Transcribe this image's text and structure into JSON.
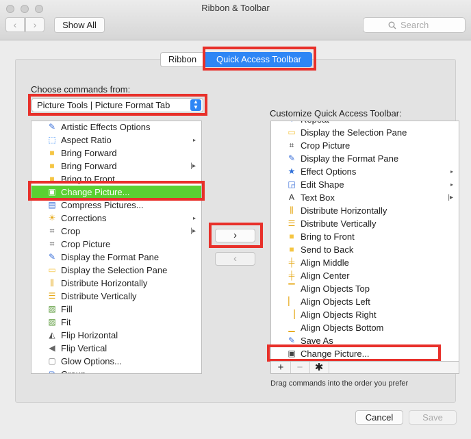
{
  "window": {
    "title": "Ribbon & Toolbar"
  },
  "toolbar": {
    "show_all": "Show All",
    "search_placeholder": "Search",
    "back": "‹",
    "forward": "›"
  },
  "tabs": {
    "ribbon": "Ribbon",
    "qat": "Quick Access Toolbar"
  },
  "left": {
    "label": "Choose commands from:",
    "selected_source": "Picture Tools | Picture Format Tab",
    "items": [
      {
        "label": "Artistic Effects Options",
        "icon": "artistic-effects-icon"
      },
      {
        "label": "Aspect Ratio",
        "icon": "aspect-ratio-icon",
        "sub": "▸"
      },
      {
        "label": "Bring Forward",
        "icon": "bring-forward-icon"
      },
      {
        "label": "Bring Forward",
        "icon": "bring-forward-icon",
        "sub": "|▸"
      },
      {
        "label": "Bring to Front",
        "icon": "bring-to-front-icon"
      },
      {
        "label": "Change Picture...",
        "icon": "change-picture-icon",
        "selected": true
      },
      {
        "label": "Compress Pictures...",
        "icon": "compress-pictures-icon"
      },
      {
        "label": "Corrections",
        "icon": "corrections-icon",
        "sub": "▸"
      },
      {
        "label": "Crop",
        "icon": "crop-icon",
        "sub": "|▸"
      },
      {
        "label": "Crop Picture",
        "icon": "crop-icon"
      },
      {
        "label": "Display the Format Pane",
        "icon": "format-pane-icon"
      },
      {
        "label": "Display the Selection Pane",
        "icon": "selection-pane-icon"
      },
      {
        "label": "Distribute Horizontally",
        "icon": "distribute-horizontally-icon"
      },
      {
        "label": "Distribute Vertically",
        "icon": "distribute-vertically-icon"
      },
      {
        "label": "Fill",
        "icon": "fill-picture-icon"
      },
      {
        "label": "Fit",
        "icon": "fit-picture-icon"
      },
      {
        "label": "Flip Horizontal",
        "icon": "flip-horizontal-icon"
      },
      {
        "label": "Flip Vertical",
        "icon": "flip-vertical-icon"
      },
      {
        "label": "Glow Options...",
        "icon": "glow-options-icon"
      },
      {
        "label": "Group",
        "icon": "group-icon"
      }
    ]
  },
  "move": {
    "add": "›",
    "remove": "‹"
  },
  "right": {
    "label": "Customize Quick Access Toolbar:",
    "items": [
      {
        "label": "Repeat",
        "icon": "repeat-icon"
      },
      {
        "label": "Display the Selection Pane",
        "icon": "selection-pane-icon"
      },
      {
        "label": "Crop Picture",
        "icon": "crop-icon"
      },
      {
        "label": "Display the Format Pane",
        "icon": "format-pane-icon"
      },
      {
        "label": "Effect Options",
        "icon": "effect-options-icon",
        "sub": "▸"
      },
      {
        "label": "Edit Shape",
        "icon": "edit-shape-icon",
        "sub": "▸"
      },
      {
        "label": "Text Box",
        "icon": "text-box-icon",
        "sub": "|▸"
      },
      {
        "label": "Distribute Horizontally",
        "icon": "distribute-horizontally-icon"
      },
      {
        "label": "Distribute Vertically",
        "icon": "distribute-vertically-icon"
      },
      {
        "label": "Bring to Front",
        "icon": "bring-to-front-icon"
      },
      {
        "label": "Send to Back",
        "icon": "send-to-back-icon"
      },
      {
        "label": "Align Middle",
        "icon": "align-middle-icon"
      },
      {
        "label": "Align Center",
        "icon": "align-center-icon"
      },
      {
        "label": "Align Objects Top",
        "icon": "align-top-icon"
      },
      {
        "label": "Align Objects Left",
        "icon": "align-left-icon"
      },
      {
        "label": "Align Objects Right",
        "icon": "align-right-icon"
      },
      {
        "label": "Align Objects Bottom",
        "icon": "align-bottom-icon"
      },
      {
        "label": "Save As",
        "icon": "save-as-icon"
      },
      {
        "label": "Change Picture...",
        "icon": "change-picture-icon"
      }
    ]
  },
  "bottom": {
    "add": "+",
    "remove": "−",
    "settings": "✱"
  },
  "hint": "Drag commands into the order you prefer",
  "footer": {
    "cancel": "Cancel",
    "save": "Save"
  },
  "colors": {
    "accent": "#2e86f5",
    "selected_row": "#5ad032",
    "highlight": "#e8302a"
  }
}
